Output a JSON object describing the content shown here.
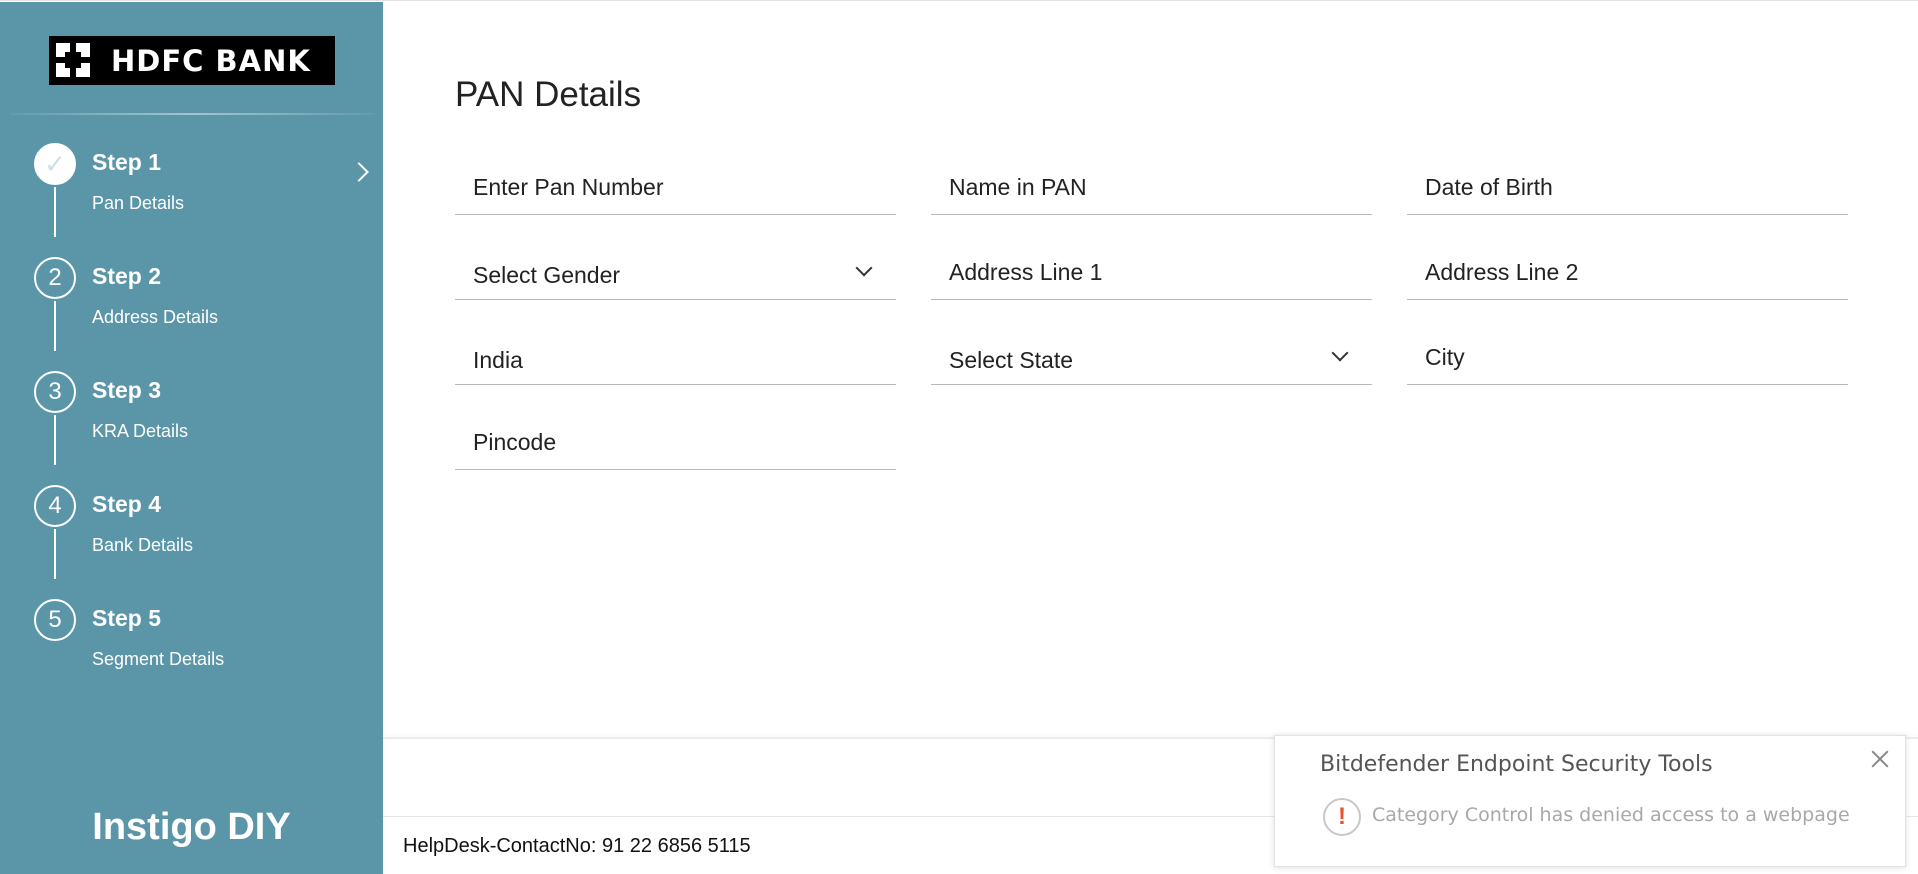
{
  "brand": {
    "logo_text": "HDFC BANK",
    "app_name": "Instigo DIY"
  },
  "steps": [
    {
      "index": "✓",
      "title": "Step 1",
      "subtitle": "Pan Details",
      "status": "completed"
    },
    {
      "index": "2",
      "title": "Step 2",
      "subtitle": "Address Details",
      "status": "pending"
    },
    {
      "index": "3",
      "title": "Step 3",
      "subtitle": "KRA Details",
      "status": "pending"
    },
    {
      "index": "4",
      "title": "Step 4",
      "subtitle": "Bank Details",
      "status": "pending"
    },
    {
      "index": "5",
      "title": "Step 5",
      "subtitle": "Segment Details",
      "status": "pending"
    }
  ],
  "main": {
    "title": "PAN Details",
    "fields": {
      "pan_number": {
        "placeholder": "Enter Pan Number",
        "value": ""
      },
      "name_in_pan": {
        "placeholder": "Name in PAN",
        "value": ""
      },
      "date_of_birth": {
        "placeholder": "Date of Birth",
        "value": ""
      },
      "gender": {
        "selected": "Select Gender"
      },
      "address_line_1": {
        "placeholder": "Address Line 1",
        "value": ""
      },
      "address_line_2": {
        "placeholder": "Address Line 2",
        "value": ""
      },
      "country": {
        "value": "India"
      },
      "state": {
        "selected": "Select State"
      },
      "city": {
        "placeholder": "City",
        "value": ""
      },
      "pincode": {
        "placeholder": "Pincode",
        "value": ""
      }
    }
  },
  "footer": {
    "helpdesk": "HelpDesk-ContactNo: 91 22 6856 5115"
  },
  "toast": {
    "title": "Bitdefender Endpoint Security Tools",
    "message": "Category Control has denied access to a webpage",
    "icon": "!"
  },
  "colors": {
    "sidebar_bg": "#5b96a8",
    "text": "#222222",
    "warning": "#e8522c"
  }
}
